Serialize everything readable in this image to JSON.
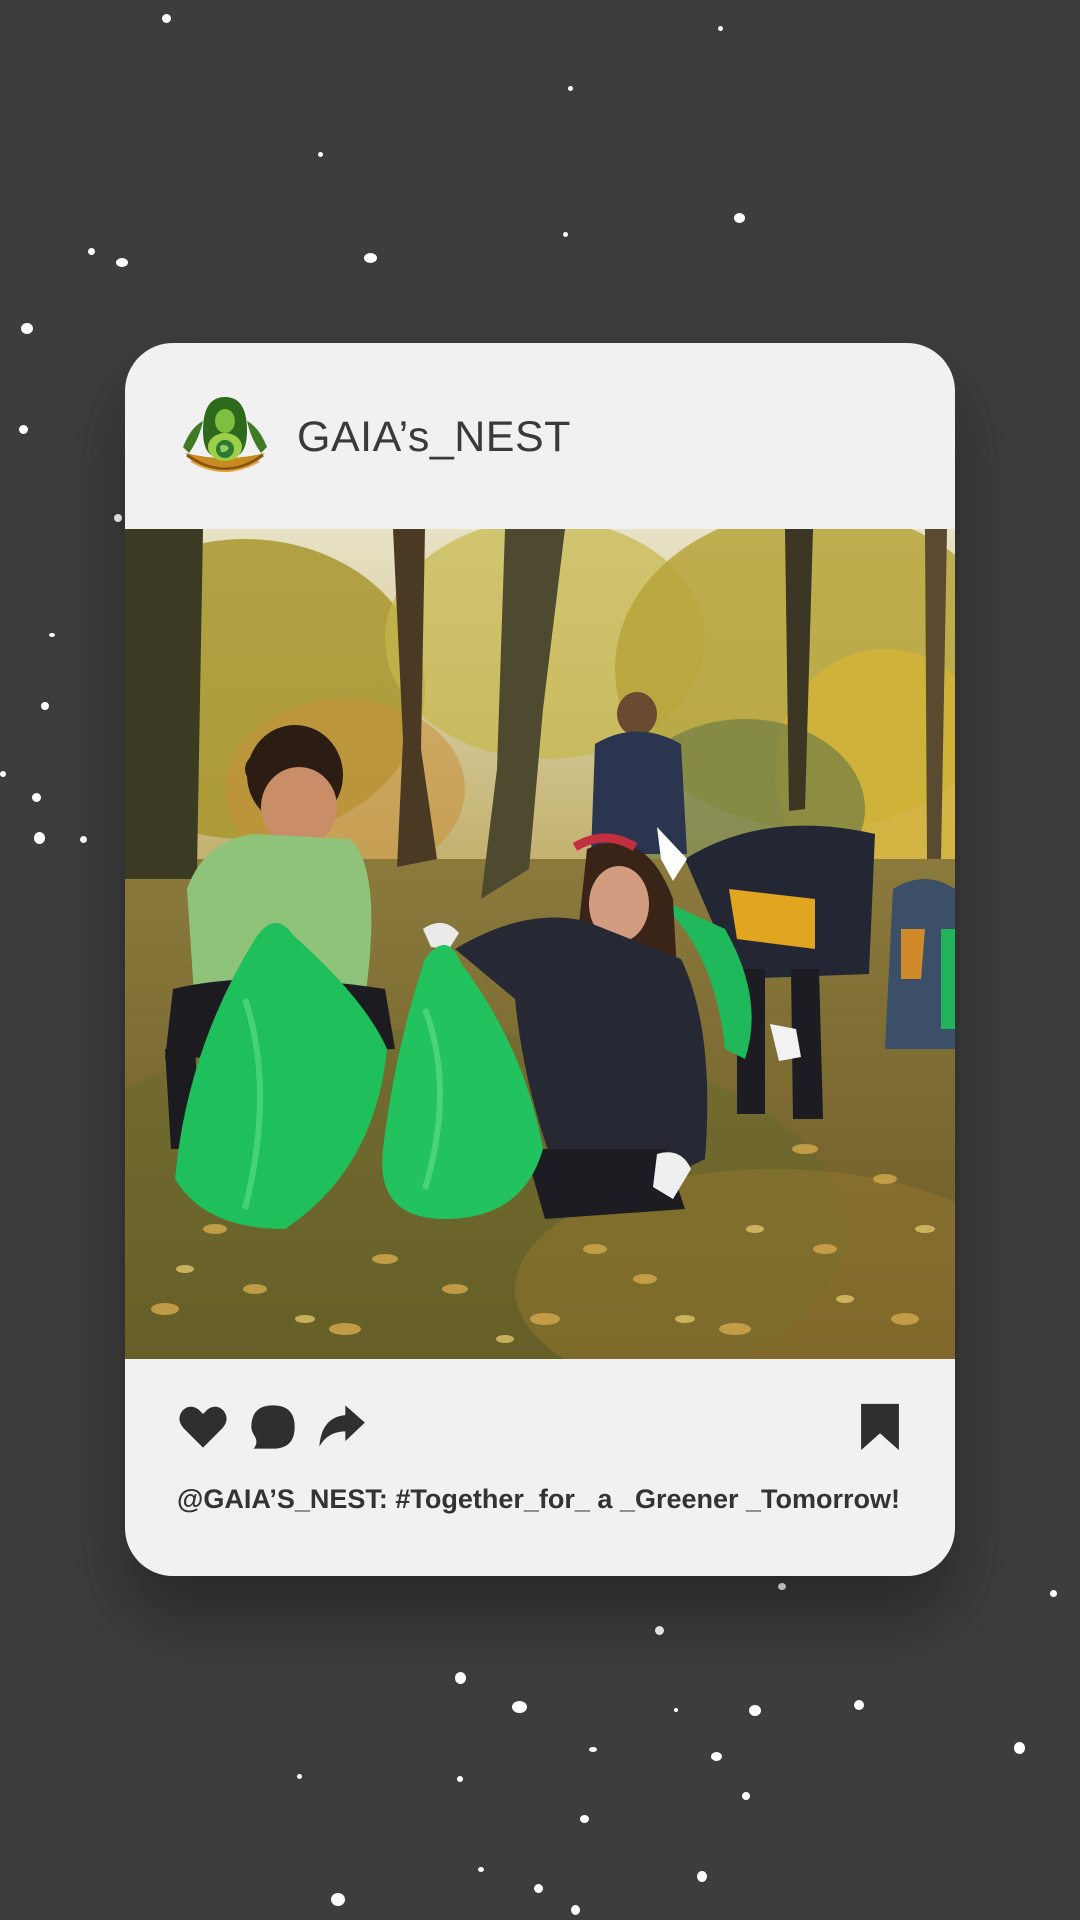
{
  "post": {
    "username": "GAIA’s_NEST",
    "caption": "@GAIA’S_NEST: #Together_for_ a _Greener _Tomorrow!",
    "avatar_icon": "earth-goddess-nest-logo",
    "image_subject": "children-collecting-leaves-in-park"
  },
  "actions": {
    "like_icon": "heart-icon",
    "comment_icon": "comment-icon",
    "share_icon": "share-arrow-icon",
    "save_icon": "bookmark-icon"
  },
  "colors": {
    "background": "#3d3d3d",
    "card": "#f1f1f1",
    "icon": "#2f2f2f",
    "text": "#333333"
  }
}
